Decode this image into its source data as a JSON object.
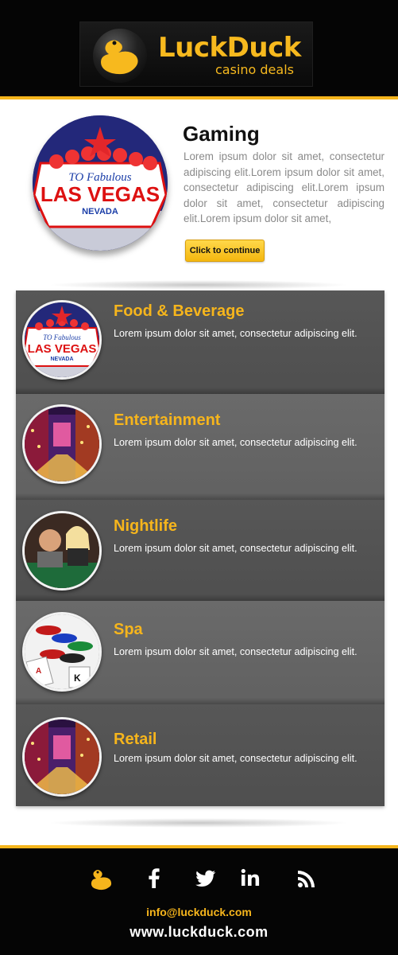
{
  "brand": {
    "name": "LuckDuck",
    "tagline": "casino deals",
    "accent_color": "#f6b51c"
  },
  "feature": {
    "title": "Gaming",
    "body": "Lorem ipsum dolor sit amet, consectetur adipiscing elit.Lorem ipsum dolor sit amet, consectetur adipiscing elit.Lorem ipsum dolor sit amet, consectetur adipiscing elit.Lorem ipsum dolor sit amet,",
    "cta_label": "Click to continue",
    "image": "las-vegas-sign"
  },
  "categories": [
    {
      "title": "Food & Beverage",
      "text": "Lorem ipsum dolor sit amet, consectetur adipiscing elit.",
      "image": "las-vegas-sign"
    },
    {
      "title": "Entertainment",
      "text": "Lorem ipsum dolor sit amet, consectetur adipiscing elit.",
      "image": "casino-strip-night"
    },
    {
      "title": "Nightlife",
      "text": "Lorem ipsum dolor sit amet, consectetur adipiscing elit.",
      "image": "people-at-table"
    },
    {
      "title": "Spa",
      "text": "Lorem ipsum dolor sit amet, consectetur adipiscing elit.",
      "image": "poker-chips-cards"
    },
    {
      "title": "Retail",
      "text": "Lorem ipsum dolor sit amet, consectetur adipiscing elit.",
      "image": "casino-strip-night"
    }
  ],
  "footer": {
    "social": [
      "duck-icon",
      "facebook-icon",
      "twitter-icon",
      "linkedin-icon",
      "rss-icon"
    ],
    "email": "info@luckduck.com",
    "website": "www.luckduck.com"
  }
}
